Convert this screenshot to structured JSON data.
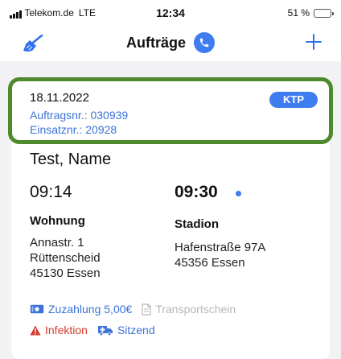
{
  "status_bar": {
    "carrier": "Telekom.de",
    "network": "LTE",
    "time": "12:34",
    "battery": "51 %",
    "battery_level": 0.51
  },
  "nav": {
    "title": "Aufträge",
    "left_icon": "broom-icon",
    "title_icon": "phone-icon",
    "right_icon": "plus-icon",
    "accent_color": "#3f7cf0"
  },
  "order": {
    "date": "18.11.2022",
    "order_number": "Auftragsnr.: 030939",
    "mission_number": "Einsatznr.: 20928",
    "badge": "KTP",
    "patient": "Test, Name",
    "start_time": "09:14",
    "end_time": "09:30",
    "from": {
      "label": "Wohnung",
      "line1": "Annastr. 1",
      "line2": "Rüttenscheid",
      "line3": "45130 Essen"
    },
    "to": {
      "label": "Stadion",
      "line1": "Hafenstraße 97A",
      "line2": "45356 Essen"
    },
    "copay": "Zuzahlung 5,00€",
    "transport_doc": "Transportschein",
    "infection": "Infektion",
    "seating": "Sitzend",
    "highlight_color": "#4e8a2d",
    "infection_color": "#d63a2f"
  }
}
